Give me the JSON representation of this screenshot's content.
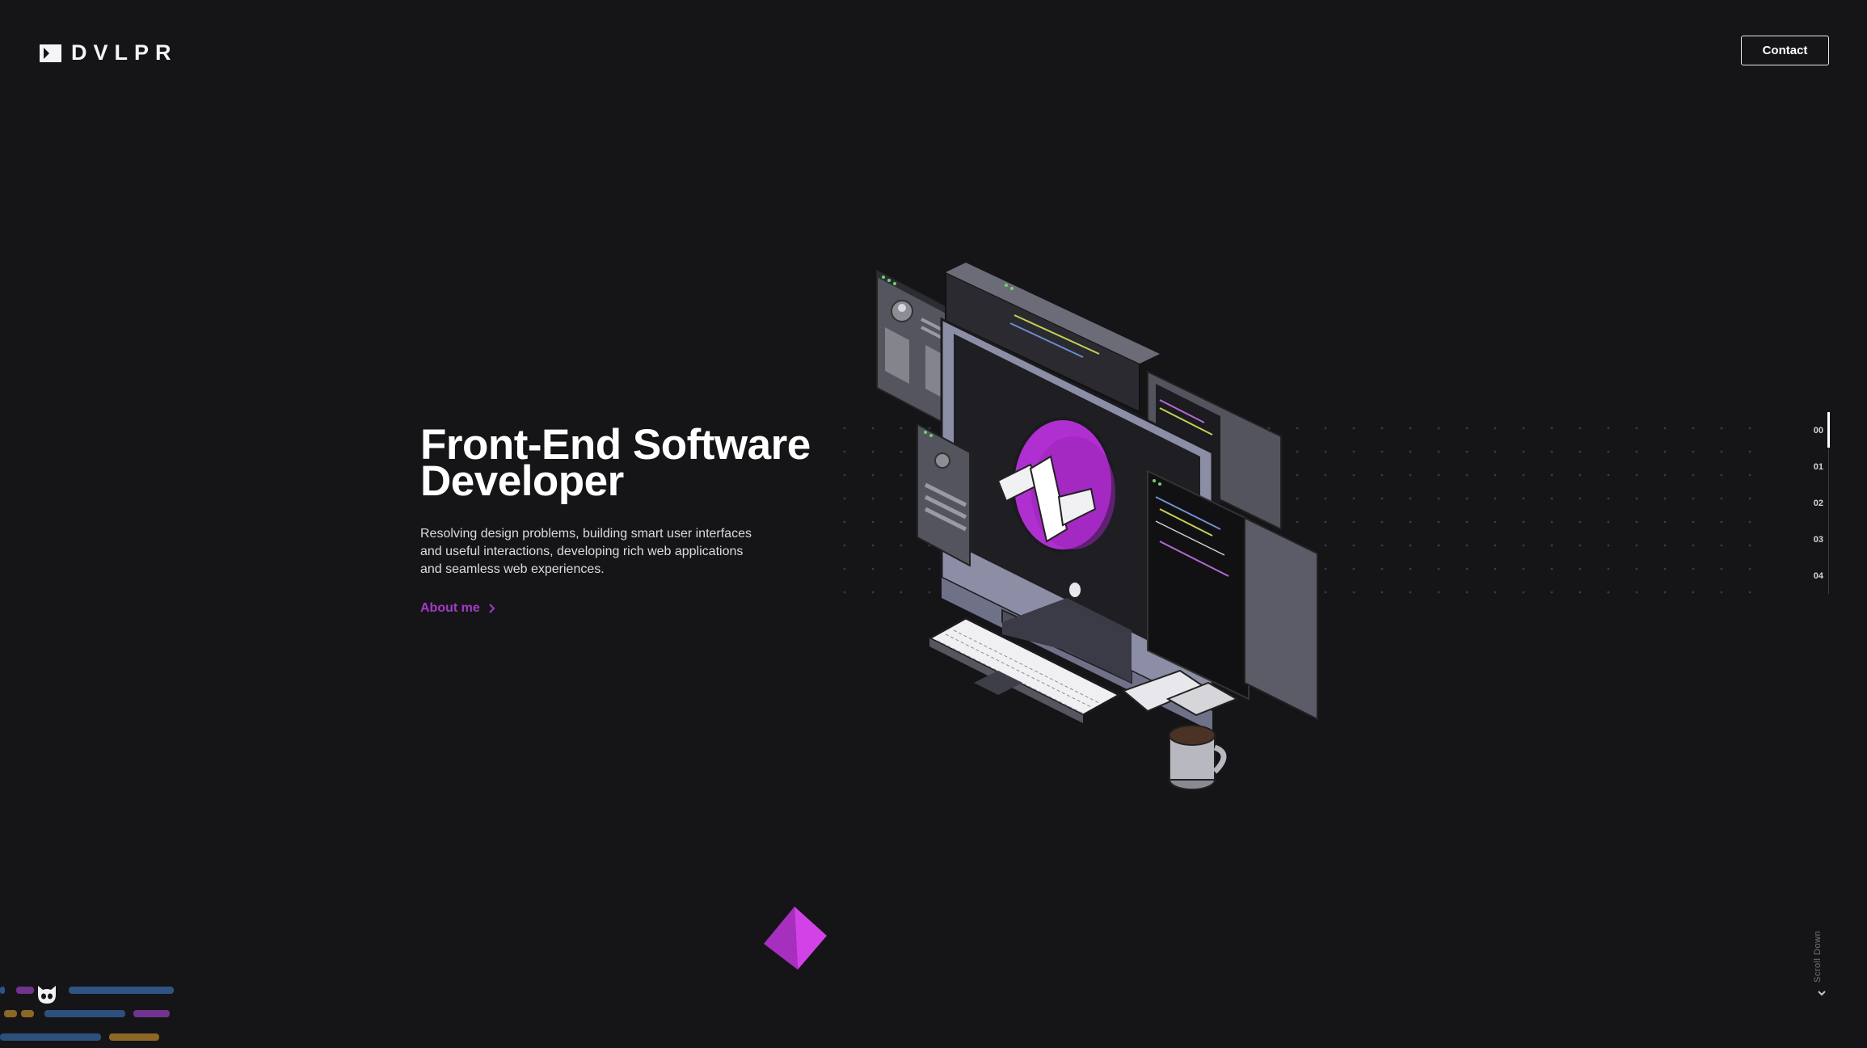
{
  "header": {
    "logo_text": "DVLPR",
    "contact_label": "Contact"
  },
  "hero": {
    "title_line1": "Front-End Software",
    "title_line2": "Developer",
    "desc_line1": "Resolving design problems, building smart user interfaces",
    "desc_line2": "and useful interactions, developing rich web applications",
    "desc_line3": "and seamless web experiences.",
    "about_label": "About me"
  },
  "illustration": {
    "badge_text": "</>"
  },
  "side_nav": {
    "items": [
      "00",
      "01",
      "02",
      "03",
      "04"
    ],
    "active": "00"
  },
  "scroll": {
    "label": "Scroll Down"
  },
  "icons": {
    "logo": "terminal-prompt-icon",
    "about_arrow": "chevron-right-icon",
    "scroll": "chevron-down-icon",
    "cat": "github-octocat-icon",
    "shape": "pyramid-icon"
  },
  "colors": {
    "background": "#151518",
    "accent": "#a33bc6",
    "badge": "#b02fd0",
    "text": "#ffffff"
  }
}
